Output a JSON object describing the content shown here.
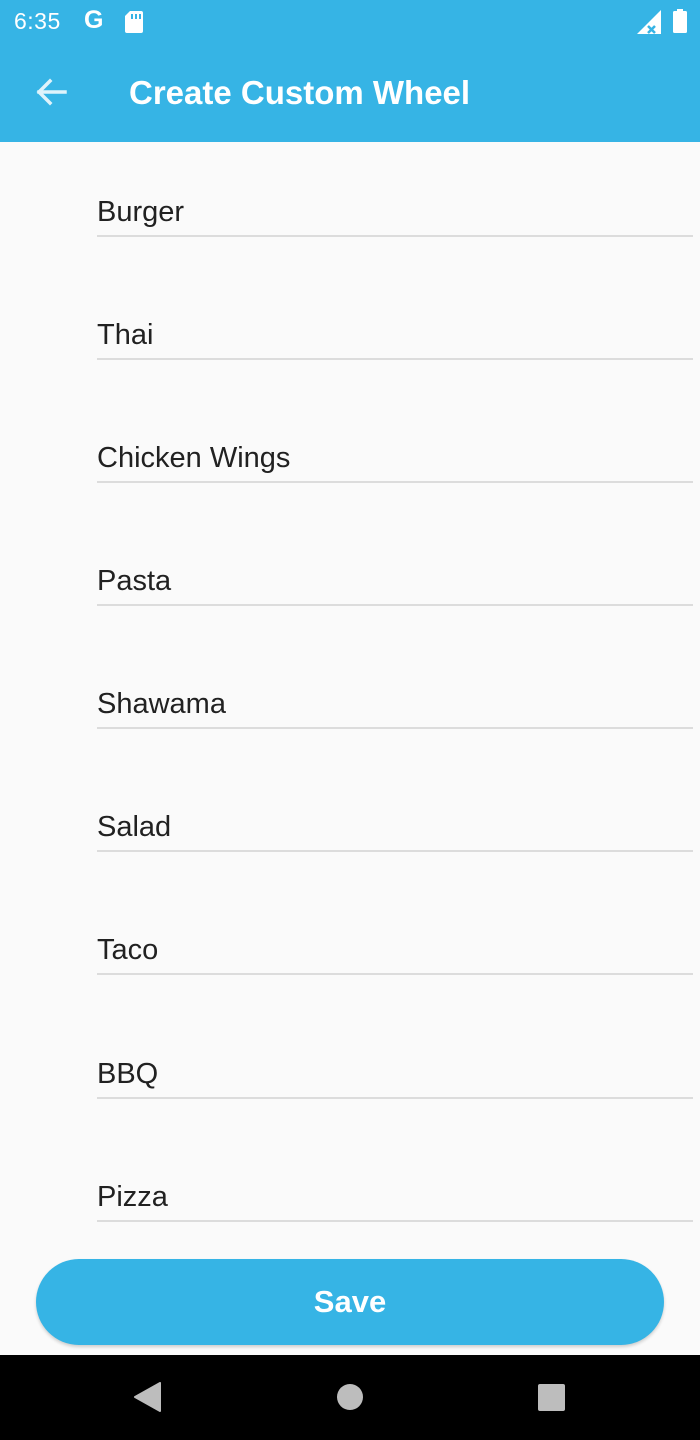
{
  "status_bar": {
    "time": "6:35",
    "google_letter": "G",
    "icons": [
      "sd-card-icon",
      "signal-icon",
      "battery-icon"
    ]
  },
  "app_bar": {
    "title": "Create Custom Wheel",
    "back_icon": "arrow-back-icon"
  },
  "items": [
    "Burger",
    "Thai",
    "Chicken Wings",
    "Pasta",
    "Shawama",
    "Salad",
    "Taco",
    "BBQ",
    "Pizza"
  ],
  "save_label": "Save",
  "colors": {
    "accent": "#36b4e5",
    "background": "#fafafa",
    "text": "#212121",
    "divider": "#dcdcdc"
  },
  "nav_bar": {
    "icons": [
      "nav-back-icon",
      "nav-home-icon",
      "nav-recent-apps-icon"
    ]
  }
}
